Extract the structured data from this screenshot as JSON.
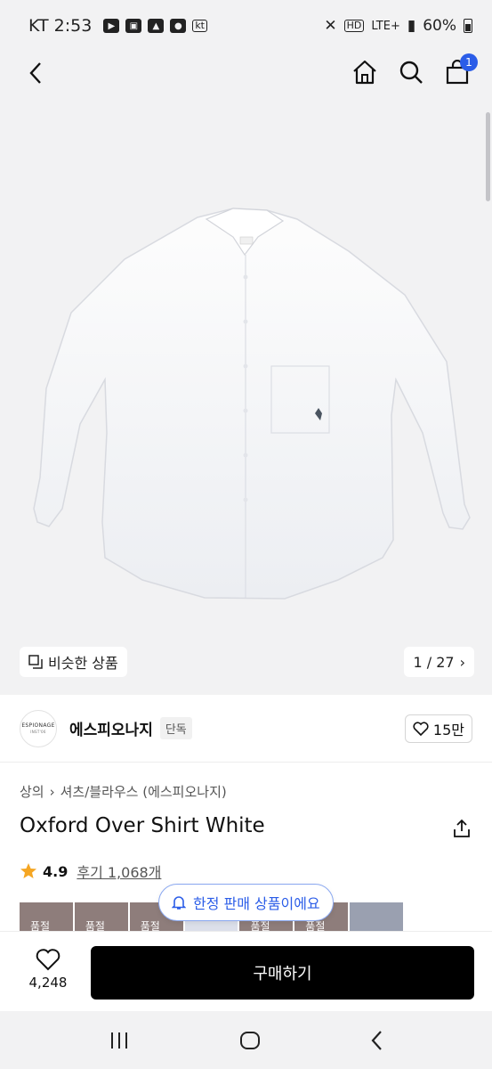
{
  "status_bar": {
    "carrier": "KT",
    "time": "2:53",
    "network": "LTE+",
    "battery": "60%",
    "hd_label": "HD",
    "kt_label": "kt"
  },
  "header": {
    "cart_count": "1"
  },
  "hero": {
    "similar_label": "비슷한 상품",
    "page_counter": "1 / 27"
  },
  "brand": {
    "logo_text": "ESPIONAGE",
    "logo_sub": "INST'06",
    "name": "에스피오나지",
    "tag": "단독",
    "likes": "15만"
  },
  "product": {
    "breadcrumb": [
      "상의",
      "셔츠/블라우스 (에스피오나지)"
    ],
    "title": "Oxford Over Shirt White",
    "rating": "4.9",
    "reviews": "후기 1,068개"
  },
  "thumbs": [
    "품절",
    "품절",
    "품절",
    "",
    "품절",
    "품절",
    "",
    ""
  ],
  "toast": "한정 판매 상품이에요",
  "bottom": {
    "like_count": "4,248",
    "buy_label": "구매하기"
  },
  "colors": {
    "accent": "#2b5de8",
    "star": "#f5a623"
  }
}
